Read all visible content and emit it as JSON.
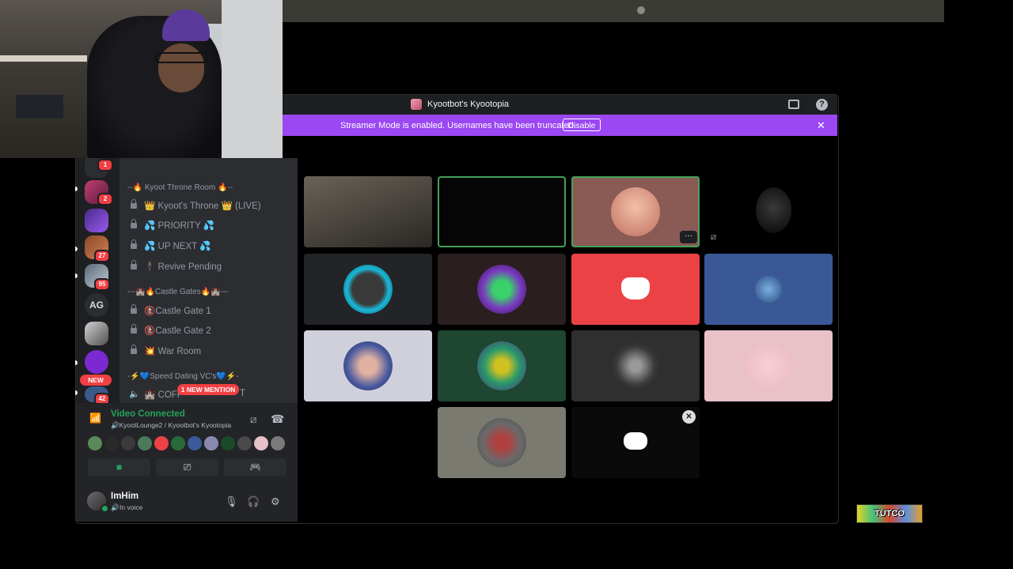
{
  "window": {
    "title": "Kyootbot's Kyootopia"
  },
  "banner": {
    "text": "Streamer Mode is enabled. Usernames have been truncated.",
    "button": "Disable"
  },
  "servers": {
    "badges": [
      "1",
      "2",
      "27",
      "95",
      "42"
    ],
    "text_server": "AG",
    "new_label": "NEW"
  },
  "channels": {
    "cat1": "--🔥 Kyoot Throne Room 🔥--",
    "items1": [
      "👑 Kyoot's Throne 👑 (LIVE)",
      "💦 PRIORITY 💦",
      "💦 UP NEXT 💦",
      "🕴 Revive Pending"
    ],
    "cat2": "---🏰🔥Castle Gates🔥🏰---",
    "items2": [
      "🚷Castle Gate 1",
      "🚷Castle Gate 2",
      "💥 War Room"
    ],
    "cat3": "-⚡💙Speed Dating VC's💙⚡-",
    "partial_item": "🏰 COFF",
    "partial_item_tail": "T",
    "mention": "1 NEW MENTION"
  },
  "voice": {
    "status": "Video Connected",
    "location": "🔊KyootLounge2 / Kyootbot's Kyootopia",
    "buttons": {
      "camera": "camera-icon",
      "screen": "screen-share-icon",
      "activity": "gamepad-icon"
    }
  },
  "user": {
    "name": "ImHim",
    "status": "In voice"
  },
  "colors": {
    "accent_purple": "#9b47f3",
    "online_green": "#23a55a",
    "discord_red": "#ed4245",
    "notification_red": "#f23f43"
  },
  "watermark": {
    "text": "TUTCO"
  }
}
